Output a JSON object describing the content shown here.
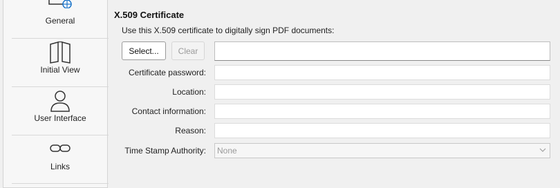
{
  "sidebar": {
    "items": [
      {
        "label": "General",
        "icon": "globe-doc-icon"
      },
      {
        "label": "Initial View",
        "icon": "open-book-icon"
      },
      {
        "label": "User Interface",
        "icon": "person-icon"
      },
      {
        "label": "Links",
        "icon": "chain-link-icon"
      }
    ]
  },
  "main": {
    "section_title": "X.509 Certificate",
    "intro": "Use this X.509 certificate to digitally sign PDF documents:",
    "select_label": "Select...",
    "clear_label": "Clear",
    "certificate_value": "",
    "fields": {
      "password": {
        "label": "Certificate password:",
        "value": ""
      },
      "location": {
        "label": "Location:",
        "value": ""
      },
      "contact": {
        "label": "Contact information:",
        "value": ""
      },
      "reason": {
        "label": "Reason:",
        "value": ""
      }
    },
    "tsa": {
      "label": "Time Stamp Authority:",
      "selected": "None"
    }
  }
}
